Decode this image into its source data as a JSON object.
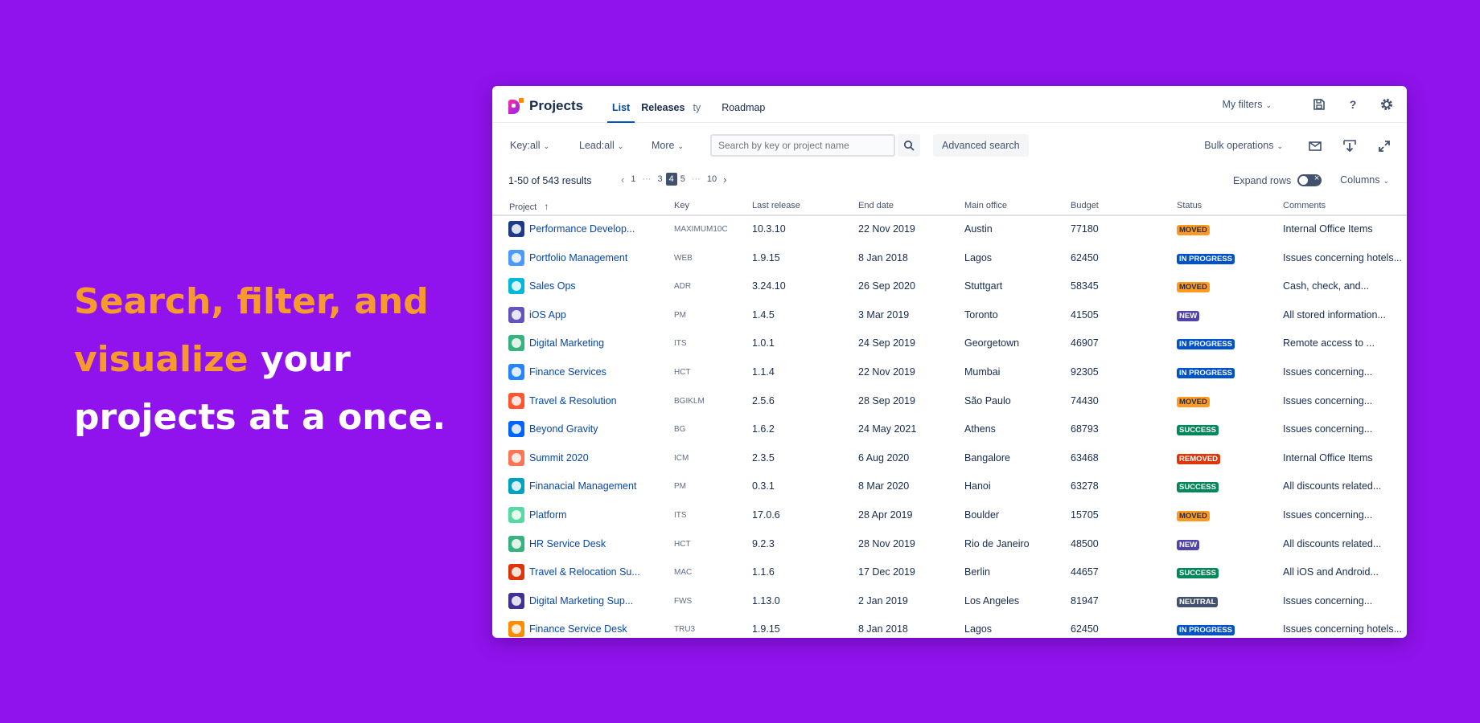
{
  "hero": {
    "line1": "Search, filter, and",
    "line2_highlight": "visualize",
    "line2_rest": " your",
    "line3": "projects at a once.",
    "highlight_color": "#f79a2e",
    "background": "#9012ec"
  },
  "app": {
    "title": "Projects",
    "tabs": [
      {
        "label": "List",
        "active": true
      },
      {
        "label": "Releases"
      },
      {
        "label": "ty"
      },
      {
        "label": "Roadmap"
      }
    ],
    "my_filters": "My filters",
    "icons": {
      "save": "save-icon",
      "help": "help-icon",
      "settings": "gear-icon"
    }
  },
  "toolbar": {
    "key_filter": "Key:all",
    "lead_filter": "Lead:all",
    "more": "More",
    "search_placeholder": "Search by key or project name",
    "advanced_search": "Advanced search",
    "bulk_operations": "Bulk operations"
  },
  "list": {
    "results": "1-50 of 543 results",
    "pages": [
      "1",
      "···",
      "3",
      "4",
      "5",
      "···",
      "10"
    ],
    "current_page": "4",
    "expand_rows": "Expand rows",
    "columns": "Columns",
    "headers": {
      "project": "Project",
      "key": "Key",
      "last_release": "Last release",
      "end_date": "End date",
      "main_office": "Main office",
      "budget": "Budget",
      "status": "Status",
      "comments": "Comments"
    }
  },
  "rows": [
    {
      "project": "Performance Develop...",
      "key": "MAXIMUM10C",
      "last": "10.3.10",
      "end": "22 Nov 2019",
      "office": "Austin",
      "budget": "77180",
      "status": "MOVED",
      "comment": "Internal Office Items",
      "avatar": "#1e3a8a"
    },
    {
      "project": "Portfolio Management",
      "key": "WEB",
      "last": "1.9.15",
      "end": "8 Jan 2018",
      "office": "Lagos",
      "budget": "62450",
      "status": "IN PROGRESS",
      "comment": "Issues concerning hotels...",
      "avatar": "#4c9aff"
    },
    {
      "project": "Sales Ops",
      "key": "ADR",
      "last": "3.24.10",
      "end": "26 Sep 2020",
      "office": "Stuttgart",
      "budget": "58345",
      "status": "MOVED",
      "comment": "Cash, check, and...",
      "avatar": "#00b8d9"
    },
    {
      "project": "iOS App",
      "key": "PM",
      "last": "1.4.5",
      "end": "3 Mar 2019",
      "office": "Toronto",
      "budget": "41505",
      "status": "NEW",
      "comment": "All stored information...",
      "avatar": "#6554c0"
    },
    {
      "project": "Digital Marketing",
      "key": "ITS",
      "last": "1.0.1",
      "end": "24 Sep 2019",
      "office": "Georgetown",
      "budget": "46907",
      "status": "IN PROGRESS",
      "comment": "Remote access to ...",
      "avatar": "#36b37e"
    },
    {
      "project": "Finance Services",
      "key": "HCT",
      "last": "1.1.4",
      "end": "22 Nov 2019",
      "office": "Mumbai",
      "budget": "92305",
      "status": "IN PROGRESS",
      "comment": "Issues concerning...",
      "avatar": "#2684ff"
    },
    {
      "project": "Travel & Resolution",
      "key": "BGIKLM",
      "last": "2.5.6",
      "end": "28 Sep 2019",
      "office": "São Paulo",
      "budget": "74430",
      "status": "MOVED",
      "comment": "Issues concerning...",
      "avatar": "#ff5630"
    },
    {
      "project": "Beyond Gravity",
      "key": "BG",
      "last": "1.6.2",
      "end": "24 May 2021",
      "office": "Athens",
      "budget": "68793",
      "status": "SUCCESS",
      "comment": "Issues concerning...",
      "avatar": "#0065ff"
    },
    {
      "project": "Summit 2020",
      "key": "ICM",
      "last": "2.3.5",
      "end": "6 Aug 2020",
      "office": "Bangalore",
      "budget": "63468",
      "status": "REMOVED",
      "comment": "Internal Office Items",
      "avatar": "#ff7452"
    },
    {
      "project": "Finanacial Management",
      "key": "PM",
      "last": "0.3.1",
      "end": "8 Mar 2020",
      "office": "Hanoi",
      "budget": "63278",
      "status": "SUCCESS",
      "comment": "All discounts related...",
      "avatar": "#00a3bf"
    },
    {
      "project": "Platform",
      "key": "ITS",
      "last": "17.0.6",
      "end": "28 Apr 2019",
      "office": "Boulder",
      "budget": "15705",
      "status": "MOVED",
      "comment": "Issues concerning...",
      "avatar": "#57d9a3"
    },
    {
      "project": "HR Service Desk",
      "key": "HCT",
      "last": "9.2.3",
      "end": "28 Nov 2019",
      "office": "Rio de Janeiro",
      "budget": "48500",
      "status": "NEW",
      "comment": "All discounts related...",
      "avatar": "#36b37e"
    },
    {
      "project": "Travel & Relocation Su...",
      "key": "MAC",
      "last": "1.1.6",
      "end": "17 Dec 2019",
      "office": "Berlin",
      "budget": "44657",
      "status": "SUCCESS",
      "comment": "All iOS and Android...",
      "avatar": "#de350b"
    },
    {
      "project": "Digital Marketing Sup...",
      "key": "FWS",
      "last": "1.13.0",
      "end": "2 Jan 2019",
      "office": "Los Angeles",
      "budget": "81947",
      "status": "NEUTRAL",
      "comment": "Issues concerning...",
      "avatar": "#403294"
    },
    {
      "project": "Finance Service Desk",
      "key": "TRU3",
      "last": "1.9.15",
      "end": "8 Jan 2018",
      "office": "Lagos",
      "budget": "62450",
      "status": "IN PROGRESS",
      "comment": "Issues concerning hotels...",
      "avatar": "#ff8b00"
    }
  ]
}
